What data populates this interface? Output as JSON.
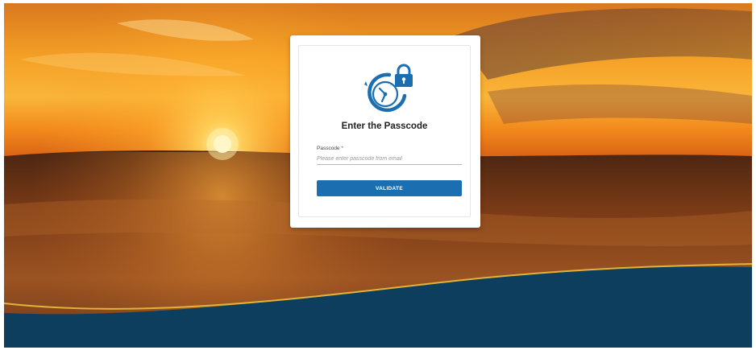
{
  "colors": {
    "accent": "#1b6fb0",
    "footer_band": "#0d3e5e",
    "gold_stripe": "#e2b23a"
  },
  "background": {
    "scene": "prairie-sunset-image"
  },
  "card": {
    "icon": "clock-lock-icon",
    "title": "Enter the Passcode",
    "passcode_label": "Passcode",
    "required_mark": "*",
    "passcode_value": "",
    "passcode_placeholder": "Please enter passcode from email",
    "validate_label": "VALIDATE"
  }
}
